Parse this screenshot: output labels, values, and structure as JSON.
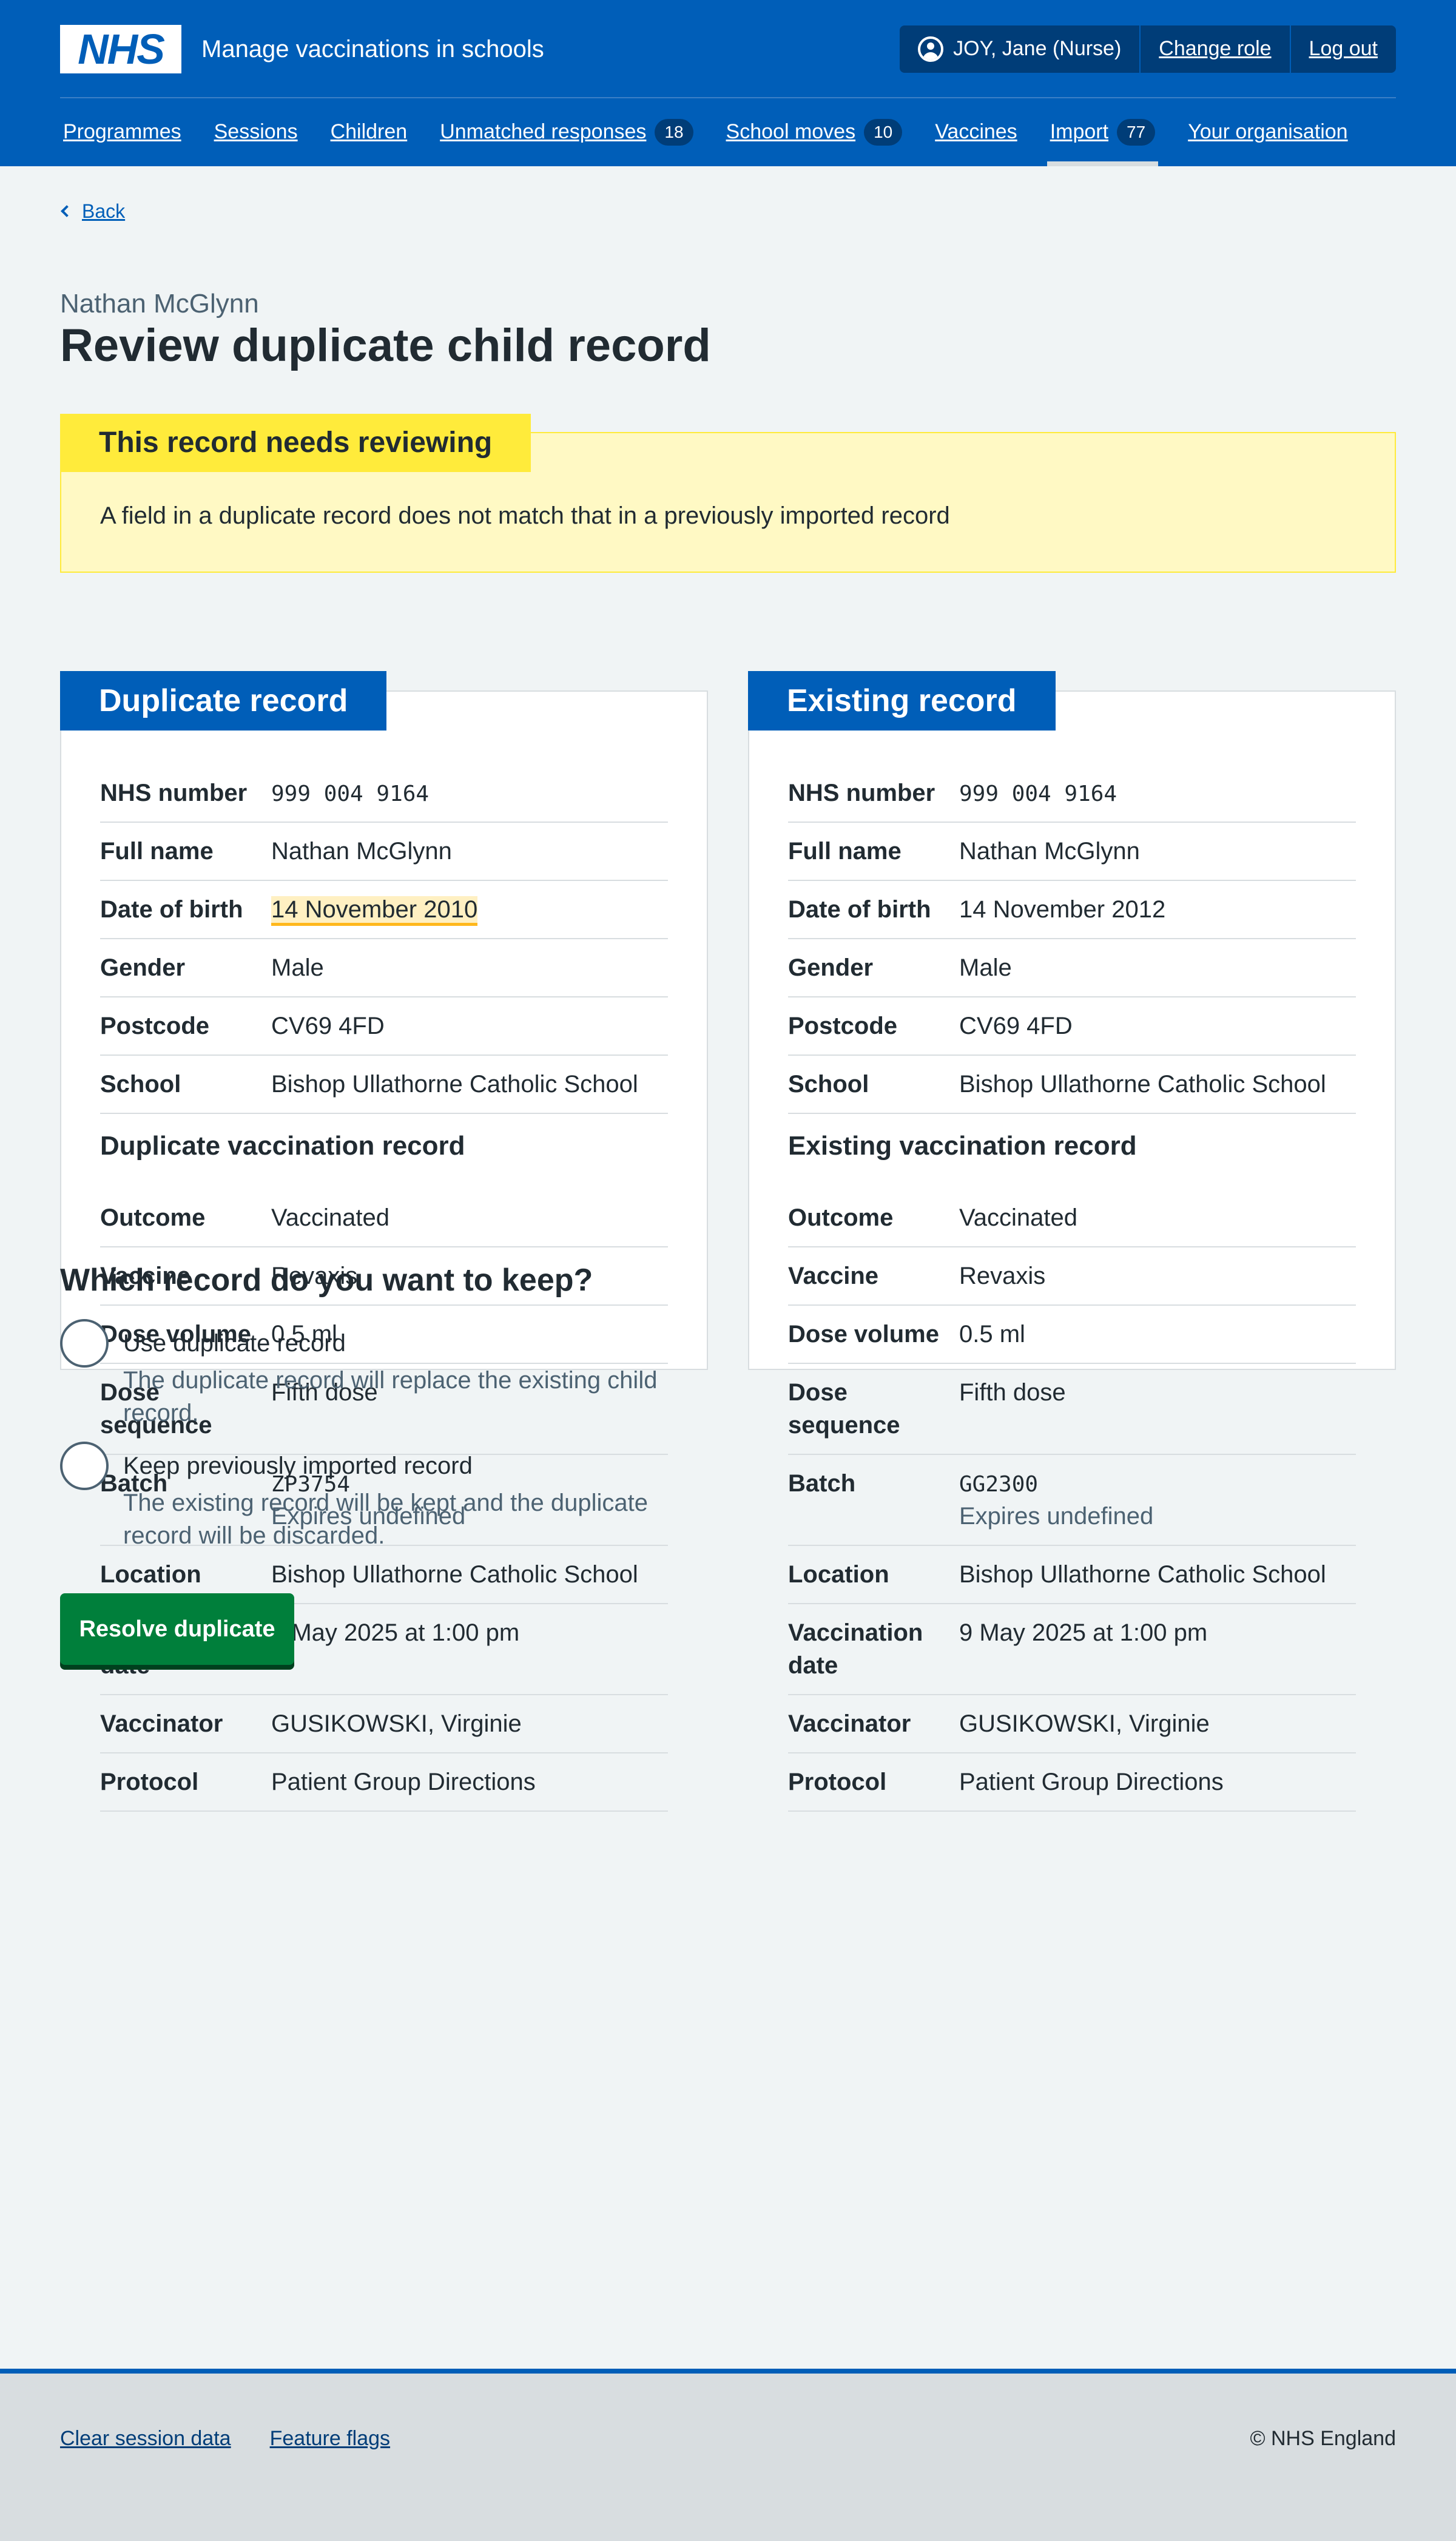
{
  "header": {
    "logo_text": "NHS",
    "service_name": "Manage vaccinations in schools",
    "user_label": "JOY, Jane (Nurse)",
    "change_role": "Change role",
    "log_out": "Log out"
  },
  "nav": [
    {
      "label": "Programmes"
    },
    {
      "label": "Sessions"
    },
    {
      "label": "Children"
    },
    {
      "label": "Unmatched responses",
      "badge": "18"
    },
    {
      "label": "School moves",
      "badge": "10"
    },
    {
      "label": "Vaccines"
    },
    {
      "label": "Import",
      "badge": "77",
      "active": true
    },
    {
      "label": "Your organisation"
    }
  ],
  "page": {
    "back": "Back",
    "caption": "Nathan McGlynn",
    "title": "Review duplicate child record"
  },
  "warning": {
    "heading": "This record needs reviewing",
    "text": "A field in a duplicate record does not match that in a previously imported record"
  },
  "duplicate": {
    "heading": "Duplicate record",
    "child": [
      {
        "key": "NHS number",
        "value": "999 004 9164",
        "mono": true
      },
      {
        "key": "Full name",
        "value": "Nathan McGlynn"
      },
      {
        "key": "Date of birth",
        "value": "14 November 2010",
        "highlight": true
      },
      {
        "key": "Gender",
        "value": "Male"
      },
      {
        "key": "Postcode",
        "value": "CV69 4FD"
      },
      {
        "key": "School",
        "value": "Bishop Ullathorne Catholic School"
      }
    ],
    "vacc_heading": "Duplicate vaccination record",
    "vaccination": [
      {
        "key": "Outcome",
        "value": "Vaccinated"
      },
      {
        "key": "Vaccine",
        "value": "Revaxis"
      },
      {
        "key": "Dose volume",
        "value": "0.5 ml"
      },
      {
        "key": "Dose sequence",
        "value": "Fifth dose"
      },
      {
        "key": "Batch",
        "value": "ZP3754",
        "hint": "Expires undefined",
        "mono": true
      },
      {
        "key": "Location",
        "value": "Bishop Ullathorne Catholic School"
      },
      {
        "key": "Vaccination date",
        "value": "9 May 2025 at 1:00 pm"
      },
      {
        "key": "Vaccinator",
        "value": "GUSIKOWSKI, Virginie"
      },
      {
        "key": "Protocol",
        "value": "Patient Group Directions"
      }
    ]
  },
  "existing": {
    "heading": "Existing record",
    "child": [
      {
        "key": "NHS number",
        "value": "999 004 9164",
        "mono": true
      },
      {
        "key": "Full name",
        "value": "Nathan McGlynn"
      },
      {
        "key": "Date of birth",
        "value": "14 November 2012"
      },
      {
        "key": "Gender",
        "value": "Male"
      },
      {
        "key": "Postcode",
        "value": "CV69 4FD"
      },
      {
        "key": "School",
        "value": "Bishop Ullathorne Catholic School"
      }
    ],
    "vacc_heading": "Existing vaccination record",
    "vaccination": [
      {
        "key": "Outcome",
        "value": "Vaccinated"
      },
      {
        "key": "Vaccine",
        "value": "Revaxis"
      },
      {
        "key": "Dose volume",
        "value": "0.5 ml"
      },
      {
        "key": "Dose sequence",
        "value": "Fifth dose"
      },
      {
        "key": "Batch",
        "value": "GG2300",
        "hint": "Expires undefined",
        "mono": true
      },
      {
        "key": "Location",
        "value": "Bishop Ullathorne Catholic School"
      },
      {
        "key": "Vaccination date",
        "value": "9 May 2025 at 1:00 pm"
      },
      {
        "key": "Vaccinator",
        "value": "GUSIKOWSKI, Virginie"
      },
      {
        "key": "Protocol",
        "value": "Patient Group Directions"
      }
    ]
  },
  "form": {
    "question": "Which record do you want to keep?",
    "options": [
      {
        "label": "Use duplicate record",
        "hint": "The duplicate record will replace the existing child record."
      },
      {
        "label": "Keep previously imported record",
        "hint": "The existing record will be kept and the duplicate record will be discarded."
      }
    ],
    "submit": "Resolve duplicate"
  },
  "footer": {
    "links": [
      "Clear session data",
      "Feature flags"
    ],
    "copyright": "© NHS England"
  },
  "colors": {
    "nhs_blue": "#005eb8",
    "dark_blue": "#003d78",
    "warning_yellow": "#ffeb3b",
    "button_green": "#007f3b"
  }
}
